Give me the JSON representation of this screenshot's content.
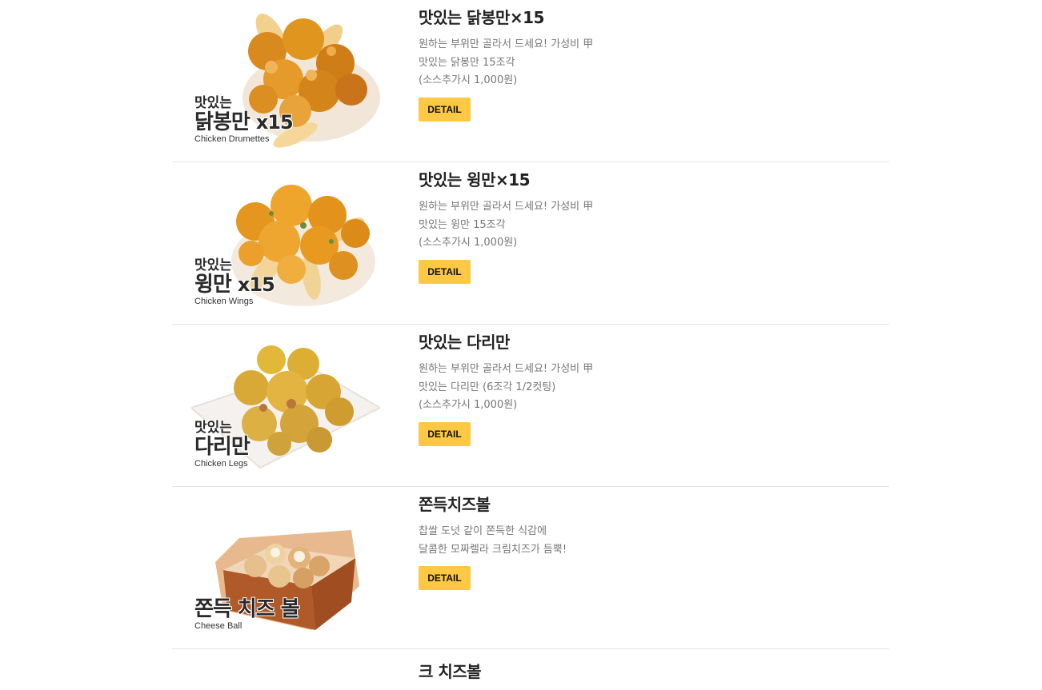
{
  "menu_items": [
    {
      "title": "맛있는 닭봉만×15",
      "desc": [
        "원하는 부위만 골라서 드세요! 가성비 甲",
        "맛있는 닭봉만 15조각",
        "(소스추가시 1,000원)"
      ],
      "button": "DETAIL",
      "image_caption": {
        "line1": "맛있는",
        "line2": "닭봉만",
        "mult": "x15",
        "en": "Chicken Drumettes"
      }
    },
    {
      "title": "맛있는 윙만×15",
      "desc": [
        "원하는 부위만 골라서 드세요! 가성비 甲",
        "맛있는 윙만 15조각",
        "(소스추가시 1,000원)"
      ],
      "button": "DETAIL",
      "image_caption": {
        "line1": "맛있는",
        "line2": "윙만",
        "mult": "x15",
        "en": "Chicken Wings"
      }
    },
    {
      "title": "맛있는 다리만",
      "desc": [
        "원하는 부위만 골라서 드세요! 가성비 甲",
        "맛있는 다리만 (6조각 1/2컷팅)",
        "(소스추가시 1,000원)"
      ],
      "button": "DETAIL",
      "image_caption": {
        "line1": "맛있는",
        "line2": "다리만",
        "mult": "",
        "en": "Chicken Legs"
      }
    },
    {
      "title": "쫀득치즈볼",
      "desc": [
        "찹쌀 도넛 같이 쫀득한 식감에",
        "달콤한 모짜렐라 크림치즈가 듬뿍!"
      ],
      "button": "DETAIL",
      "image_caption": {
        "line1": "",
        "line2": "쫀득 치즈 볼",
        "mult": "",
        "en": "Cheese Ball"
      }
    },
    {
      "title": "크 치즈볼"
    }
  ],
  "colors": {
    "button": "#fdc843",
    "divider": "#e4e4e4",
    "desc_text": "#777777"
  }
}
